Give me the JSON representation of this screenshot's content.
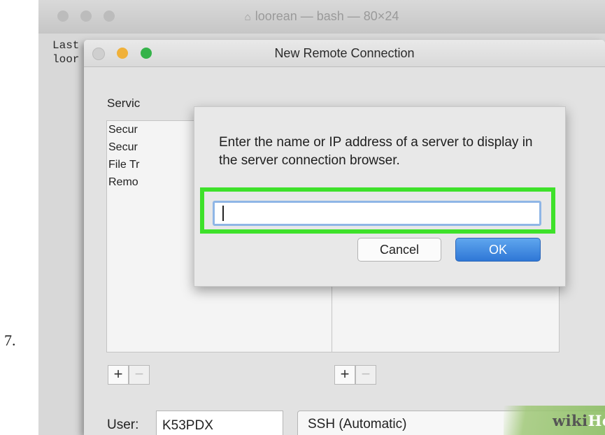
{
  "step_number": "7.",
  "terminal": {
    "title": "loorean — bash — 80×24",
    "line1": "Last",
    "line2": "loor"
  },
  "connection_window": {
    "title": "New Remote Connection",
    "services_label": "Servic",
    "services": [
      "Secur",
      "Secur",
      "File Tr",
      "Remo"
    ],
    "add_symbol": "+",
    "remove_symbol": "−",
    "user_label": "User:",
    "user_value": "K53PDX",
    "protocol_value": "SSH (Automatic)"
  },
  "dialog": {
    "message": "Enter the name or IP address of a server to display in the server connection browser.",
    "input_value": "",
    "cancel_label": "Cancel",
    "ok_label": "OK"
  },
  "colors": {
    "highlight": "#3ee12a",
    "ok_button": "#2f77d6",
    "minimize": "#f0b13a",
    "maximize": "#35b34a"
  },
  "watermark": {
    "wiki": "wiki",
    "how": "How"
  }
}
